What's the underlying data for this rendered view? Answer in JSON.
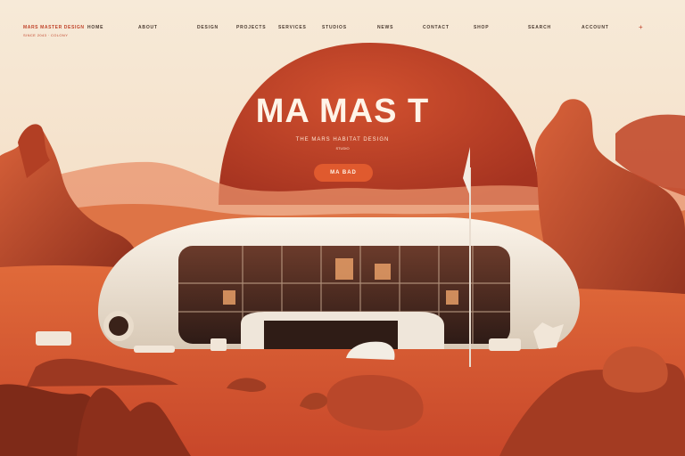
{
  "nav": {
    "brand": "MARS MASTER DESIGN",
    "brand_sub": "SINCE 2043 · COLONY",
    "items": [
      "HOME",
      "ABOUT",
      "DESIGN",
      "PROJECTS",
      "SERVICES",
      "STUDIOS",
      "NEWS",
      "CONTACT",
      "SHOP",
      "SEARCH",
      "ACCOUNT"
    ],
    "menu_icon": "plus-icon"
  },
  "hero": {
    "title": "MA MAS T",
    "subtitle": "THE MARS HABITAT DESIGN",
    "subtitle_small": "STUDIO",
    "cta_label": "MA BAD"
  },
  "colors": {
    "sky": "#f6e7d2",
    "planet": "#c8452a",
    "ground": "#d9592d",
    "accent": "#e05a2e",
    "dome": "#f1e8dc"
  }
}
